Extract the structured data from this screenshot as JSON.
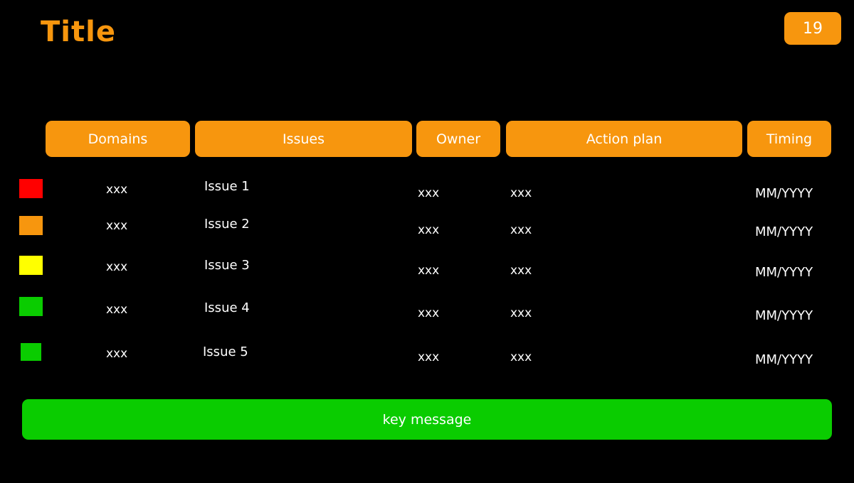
{
  "header": {
    "title": "Title",
    "badge": "19"
  },
  "theme": {
    "background": "#000000",
    "accent_orange": "#F7960E",
    "accent_green": "#0ACC00",
    "text": "#FFFFFF"
  },
  "table": {
    "columns": [
      {
        "label": "Domains"
      },
      {
        "label": "Issues"
      },
      {
        "label": "Owner"
      },
      {
        "label": "Action plan"
      },
      {
        "label": "Timing"
      }
    ],
    "rows": [
      {
        "status_color": "#FF0000",
        "status_name": "status-red",
        "domain": "xxx",
        "issue": "Issue 1",
        "owner": "xxx",
        "action_plan": "xxx",
        "timing": "MM/YYYY"
      },
      {
        "status_color": "#F7960E",
        "status_name": "status-orange",
        "domain": "xxx",
        "issue": "Issue 2",
        "owner": "xxx",
        "action_plan": "xxx",
        "timing": "MM/YYYY"
      },
      {
        "status_color": "#FFFF00",
        "status_name": "status-yellow",
        "domain": "xxx",
        "issue": "Issue 3",
        "owner": "xxx",
        "action_plan": "xxx",
        "timing": "MM/YYYY"
      },
      {
        "status_color": "#0ACC00",
        "status_name": "status-green",
        "domain": "xxx",
        "issue": "Issue 4",
        "owner": "xxx",
        "action_plan": "xxx",
        "timing": "MM/YYYY"
      },
      {
        "status_color": "#0ACC00",
        "status_name": "status-green",
        "domain": "xxx",
        "issue": "Issue 5",
        "owner": "xxx",
        "action_plan": "xxx",
        "timing": "MM/YYYY"
      }
    ]
  },
  "footer": {
    "key_message": "key message"
  }
}
